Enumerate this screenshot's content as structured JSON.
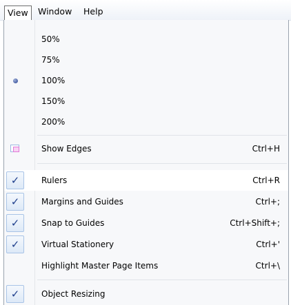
{
  "menubar": {
    "items": [
      {
        "label": "View"
      },
      {
        "label": "Window"
      },
      {
        "label": "Help"
      }
    ]
  },
  "menu": {
    "zoom": [
      {
        "label": "50%",
        "selected": false
      },
      {
        "label": "75%",
        "selected": false
      },
      {
        "label": "100%",
        "selected": true
      },
      {
        "label": "150%",
        "selected": false
      },
      {
        "label": "200%",
        "selected": false
      }
    ],
    "show_edges": {
      "label": "Show Edges",
      "shortcut": "Ctrl+H",
      "icon": "show-edges-icon"
    },
    "toggles": [
      {
        "label": "Rulers",
        "shortcut": "Ctrl+R",
        "checked": true
      },
      {
        "label": "Margins and Guides",
        "shortcut": "Ctrl+;",
        "checked": true
      },
      {
        "label": "Snap to Guides",
        "shortcut": "Ctrl+Shift+;",
        "checked": true
      },
      {
        "label": "Virtual Stationery",
        "shortcut": "Ctrl+'",
        "checked": true
      },
      {
        "label": "Highlight Master Page Items",
        "shortcut": "Ctrl+\\",
        "checked": false
      }
    ],
    "object_resizing": {
      "label": "Object Resizing",
      "checked": true
    }
  },
  "colors": {
    "check": "#1e3f8c",
    "menu_bg": "#f7f8fa",
    "checked_box_border": "#a8c3e6"
  }
}
